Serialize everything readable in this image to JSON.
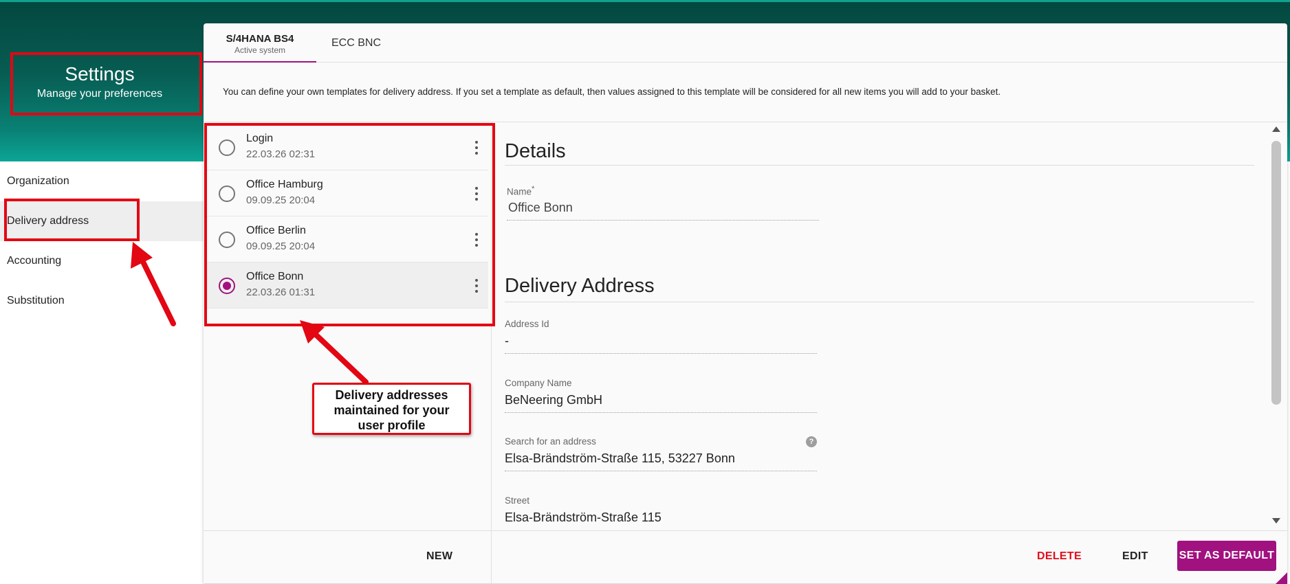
{
  "header": {
    "title": "Settings",
    "subtitle": "Manage your preferences"
  },
  "sidebar": {
    "items": [
      {
        "label": "Organization"
      },
      {
        "label": "Delivery address"
      },
      {
        "label": "Accounting"
      },
      {
        "label": "Substitution"
      }
    ]
  },
  "tabs": [
    {
      "label": "S/4HANA BS4",
      "sublabel": "Active system"
    },
    {
      "label": "ECC BNC"
    }
  ],
  "intro": "You can define your own templates for delivery address. If you set a template as default, then values assigned to this template will be considered for all new items you will add to your basket.",
  "addresses": [
    {
      "name": "Login",
      "date": "22.03.26 02:31"
    },
    {
      "name": "Office Hamburg",
      "date": "09.09.25 20:04"
    },
    {
      "name": "Office Berlin",
      "date": "09.09.25 20:04"
    },
    {
      "name": "Office Bonn",
      "date": "22.03.26 01:31"
    }
  ],
  "details": {
    "section_title": "Details",
    "name_label": "Name",
    "name_required_mark": "*",
    "name_value": "Office Bonn",
    "delivery_title": "Delivery Address",
    "address_id_label": "Address Id",
    "address_id_value": "-",
    "company_label": "Company Name",
    "company_value": "BeNeering GmbH",
    "search_label": "Search for an address",
    "search_value": "Elsa-Brändström-Straße 115, 53227 Bonn",
    "help_glyph": "?",
    "street_label": "Street",
    "street_value": "Elsa-Brändström-Straße 115"
  },
  "footer": {
    "new_label": "NEW",
    "delete_label": "DELETE",
    "edit_label": "EDIT",
    "set_default_label": "SET AS DEFAULT"
  },
  "annotation": {
    "callout_line1": "Delivery addresses",
    "callout_line2": "maintained for your",
    "callout_line3": "user profile"
  },
  "colors": {
    "brand_dark": "#04473f",
    "brand_teal": "#0ba596",
    "accent_magenta": "#a1117f",
    "delete_red": "#e30d1c",
    "annotation_red": "#e30613"
  }
}
